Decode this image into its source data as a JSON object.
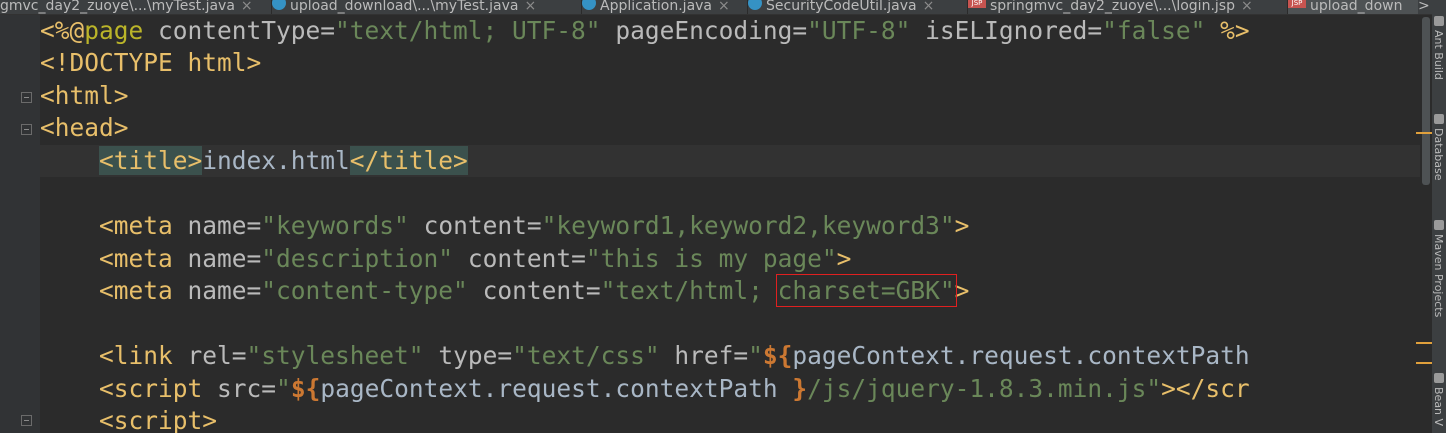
{
  "tabs": [
    {
      "label": "gmvc_day2_zuoye\\...\\myTest.java",
      "icon": "java-class-icon",
      "active": false
    },
    {
      "label": "upload_download\\...\\myTest.java",
      "icon": "java-class-icon",
      "active": false
    },
    {
      "label": "Application.java",
      "icon": "java-class-icon",
      "active": false
    },
    {
      "label": "SecurityCodeUtil.java",
      "icon": "java-class-icon",
      "active": false
    },
    {
      "label": "springmvc_day2_zuoye\\...\\login.jsp",
      "icon": "jsp-file-icon",
      "active": false
    },
    {
      "label": "upload_down",
      "icon": "jsp-file-icon",
      "active": true
    }
  ],
  "tab_close": "×",
  "tab_more": ">",
  "editor": {
    "l1": {
      "open": "<%@",
      "directive": "page",
      "a1": " contentType=",
      "v1": "\"text/html; UTF-8\"",
      "a2": " pageEncoding=",
      "v2": "\"UTF-8\"",
      "a3": " isELIgnored=",
      "v3": "\"false\"",
      "close": " %>"
    },
    "l2": "<!DOCTYPE html>",
    "l3": "<html>",
    "l4": "<head>",
    "l5": {
      "indent": "    ",
      "open_tag": "<title>",
      "text": "index.html",
      "close_tag": "</title>"
    },
    "l7": {
      "indent": "    ",
      "tag": "<meta",
      "a1": " name=",
      "v1": "\"keywords\"",
      "a2": " content=",
      "v2": "\"keyword1,keyword2,keyword3\"",
      "end": ">"
    },
    "l8": {
      "indent": "    ",
      "tag": "<meta",
      "a1": " name=",
      "v1": "\"description\"",
      "a2": " content=",
      "v2": "\"this is my page\"",
      "end": ">"
    },
    "l9": {
      "indent": "    ",
      "tag": "<meta",
      "a1": " name=",
      "v1": "\"content-type\"",
      "a2": " content=",
      "v2a": "\"text/html; ",
      "v2b": "charset=GBK\"",
      "end": ">"
    },
    "l11": {
      "indent": "    ",
      "tag": "<link",
      "a1": " rel=",
      "v1": "\"stylesheet\"",
      "a2": " type=",
      "v2": "\"text/css\"",
      "a3": " href=",
      "v3q": "\"",
      "el": "${",
      "expr": "pageContext.request.contextPath"
    },
    "l12": {
      "indent": "    ",
      "tag": "<script",
      "a1": " src=",
      "v1q": "\"",
      "el": "${",
      "expr": "pageContext.request.contextPath ",
      "el_close": "}",
      "v1rest": "/js/jquery-1.8.3.min.js\"",
      "end": "></scr"
    },
    "l13": {
      "indent": "    ",
      "tag": "<script>"
    }
  },
  "tool_windows": [
    "Ant Build",
    "Database",
    "Maven Projects",
    "Bean V"
  ],
  "colors": {
    "background": "#2b2b2b",
    "tag": "#e8bf6a",
    "attribute": "#bababa",
    "string": "#6a8759",
    "keyword": "#cc7832",
    "directive": "#bbb529",
    "highlight_box": "#e02020"
  }
}
